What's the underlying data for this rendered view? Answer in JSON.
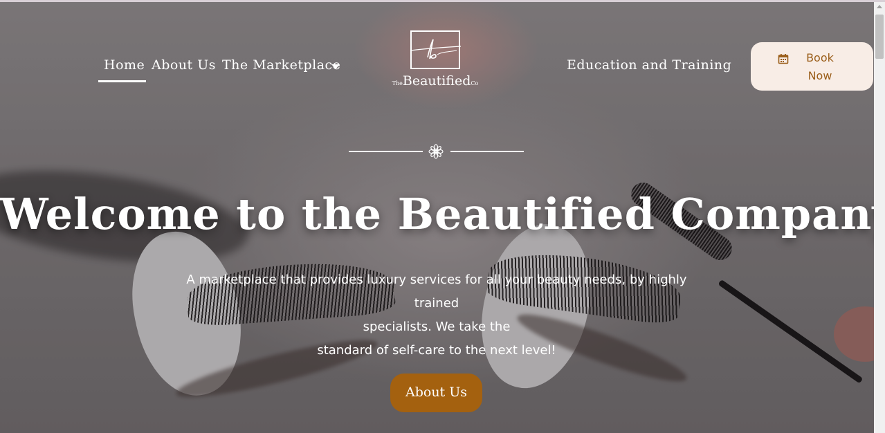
{
  "nav": {
    "home": "Home",
    "about": "About Us",
    "marketplace": "The Marketplace",
    "education": "Education and Training"
  },
  "logo": {
    "word": "Beautified",
    "prefix": "The",
    "suffix": "Co"
  },
  "book_button": {
    "line1": "Book",
    "line2": "Now",
    "icon": "calendar-icon"
  },
  "hero": {
    "headline": "Welcome to the Beautified Company",
    "subtitle_lines": [
      "A marketplace that provides luxury services for all your beauty needs, by highly trained",
      "specialists. We take the",
      "standard of self-care to the next level!"
    ],
    "cta": "About Us",
    "ornament_icon": "flower-icon"
  },
  "colors": {
    "accent_button": "#a4610f",
    "book_bg": "#f8ede6",
    "book_text": "#9b5f1b",
    "text": "#ffffff"
  }
}
